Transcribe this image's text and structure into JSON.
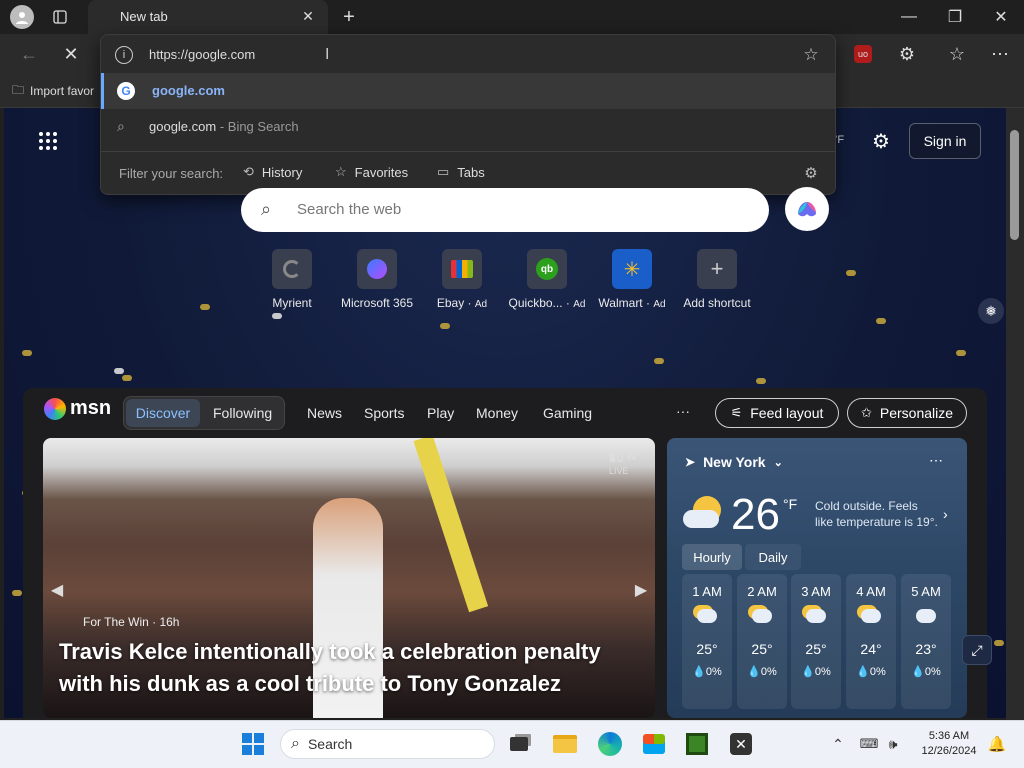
{
  "browser": {
    "tab_title": "New tab",
    "omnibox": {
      "url_text": "https://google.com",
      "suggestion_1": "google.com",
      "suggestion_2": "google.com",
      "suggestion_2_suffix": " - Bing Search",
      "filter_label": "Filter your search:",
      "filters": [
        "History",
        "Favorites",
        "Tabs"
      ]
    },
    "favorites_bar": {
      "import_label": "Import favor"
    }
  },
  "newtab": {
    "sign_in": "Sign in",
    "temp_unit_hint": "°F",
    "search_placeholder": "Search the web",
    "shortcuts": [
      {
        "label": "Myrient",
        "ad": ""
      },
      {
        "label": "Microsoft 365",
        "ad": ""
      },
      {
        "label": "Ebay",
        "ad": "Ad"
      },
      {
        "label": "Quickbo...",
        "ad": "Ad"
      },
      {
        "label": "Walmart",
        "ad": "Ad"
      },
      {
        "label": "Add shortcut",
        "ad": ""
      }
    ]
  },
  "feed": {
    "brand": "msn",
    "tabs": [
      "Discover",
      "Following"
    ],
    "nav": [
      "News",
      "Sports",
      "Play",
      "Money",
      "Gaming"
    ],
    "more": "···",
    "feed_layout": "Feed layout",
    "personalize": "Personalize",
    "hero": {
      "source": "For The Win · 16h",
      "headline": "Travis Kelce intentionally took a celebration penalty with his dunk as a cool tribute to Tony Gonzalez",
      "badge_live": "LIVE"
    },
    "weather": {
      "location": "New York",
      "temp": "26",
      "unit": "°F",
      "note": "Cold outside. Feels like temperature is 19°.",
      "tabs": [
        "Hourly",
        "Daily"
      ],
      "hours": [
        {
          "time": "1 AM",
          "temp": "25°",
          "precip": "0%"
        },
        {
          "time": "2 AM",
          "temp": "25°",
          "precip": "0%"
        },
        {
          "time": "3 AM",
          "temp": "25°",
          "precip": "0%"
        },
        {
          "time": "4 AM",
          "temp": "24°",
          "precip": "0%"
        },
        {
          "time": "5 AM",
          "temp": "23°",
          "precip": "0%"
        }
      ]
    }
  },
  "taskbar": {
    "search_label": "Search",
    "time": "5:36 AM",
    "date": "12/26/2024"
  }
}
